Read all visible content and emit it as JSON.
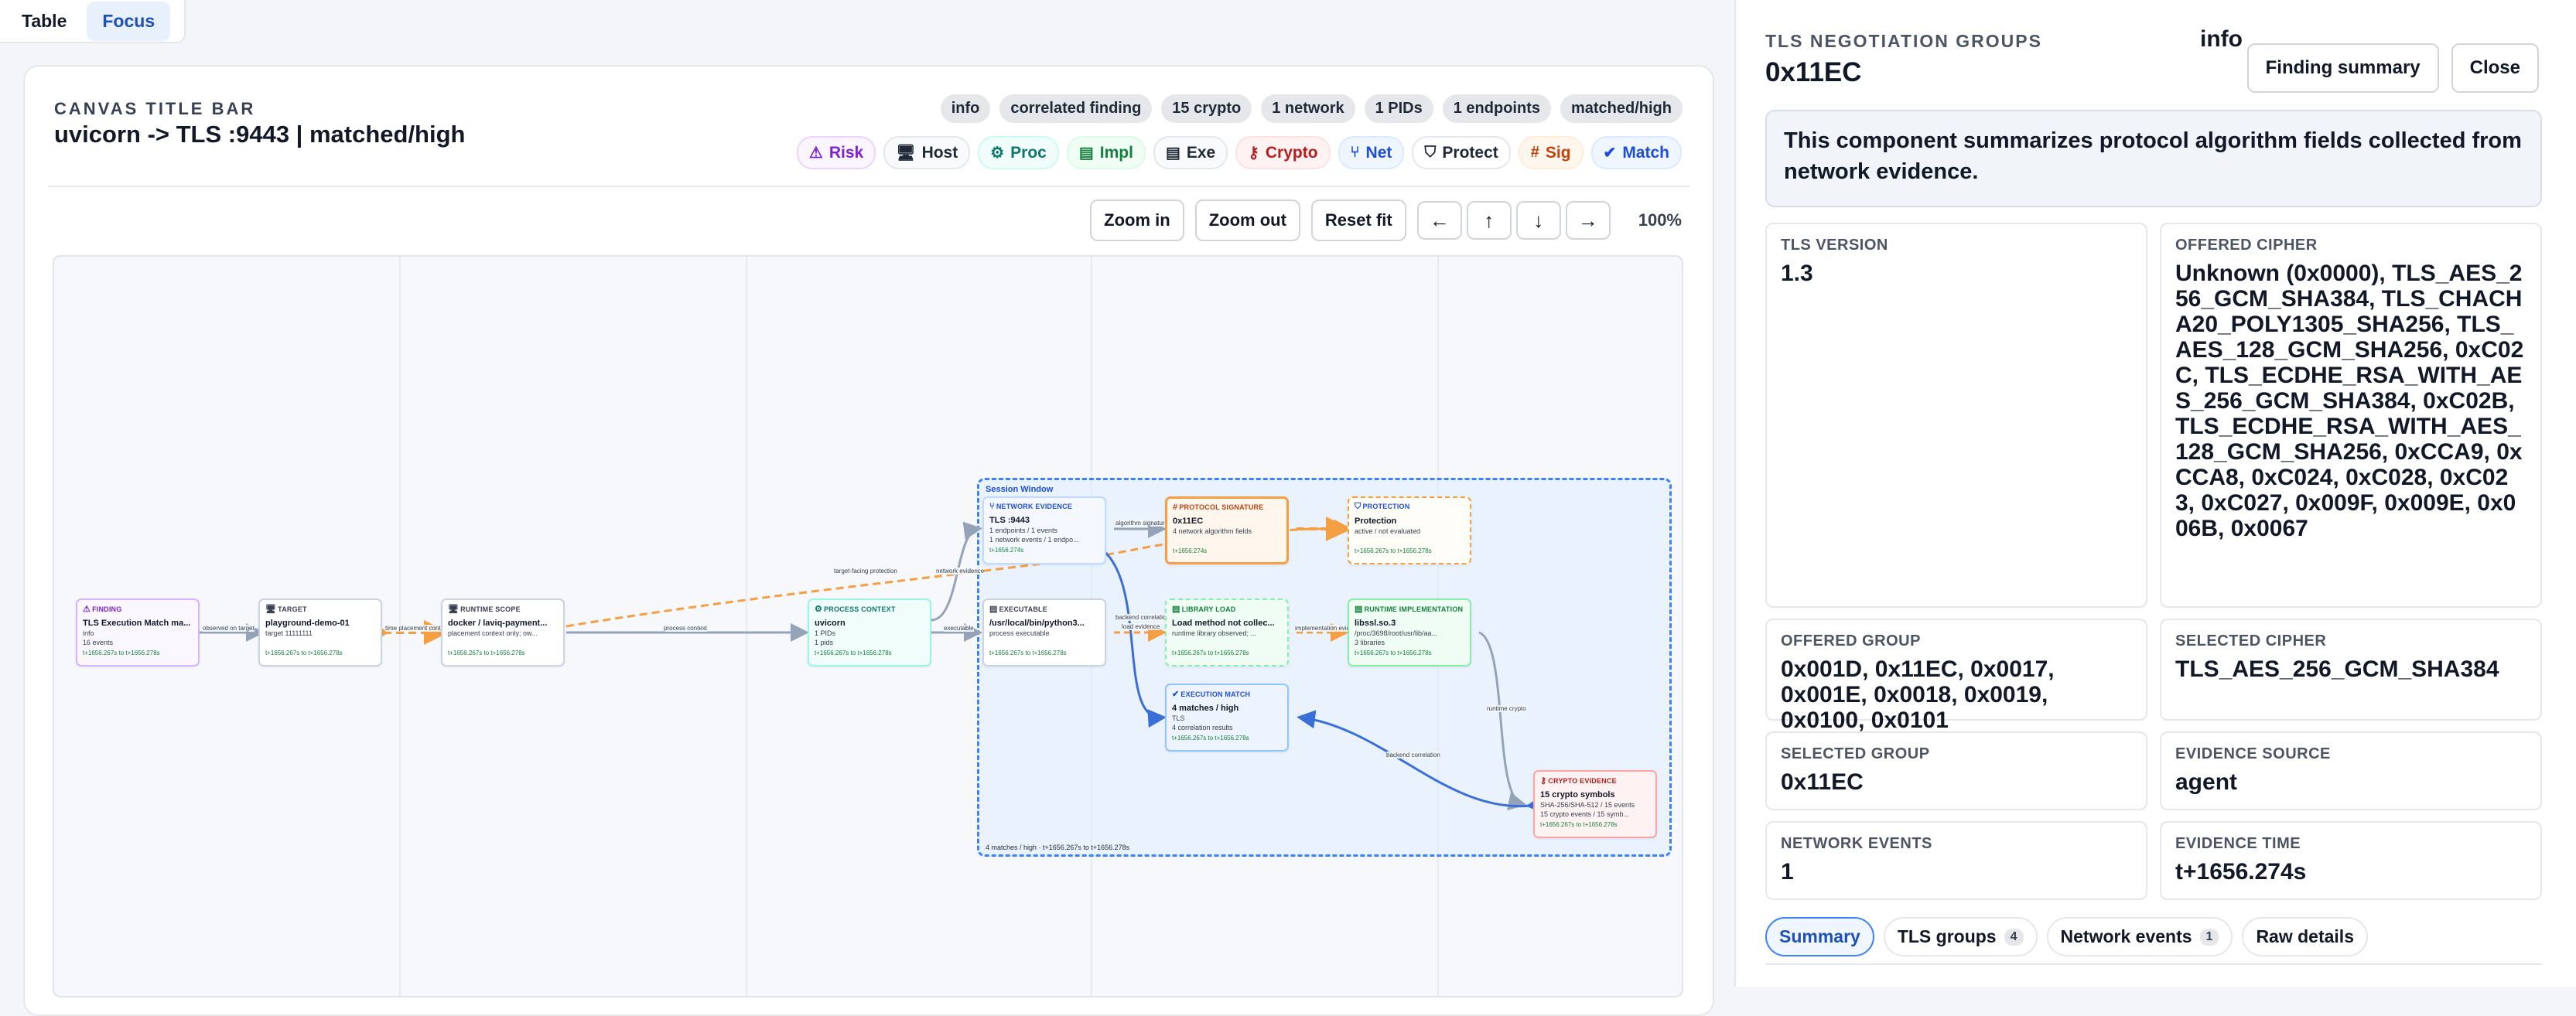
{
  "top_tabs": [
    {
      "label": "Table",
      "active": false
    },
    {
      "label": "Focus",
      "active": true
    }
  ],
  "canvas": {
    "bar_label": "CANVAS TITLE BAR",
    "title": "uvicorn -> TLS :9443 | matched/high",
    "badges": [
      "info",
      "correlated finding",
      "15 crypto",
      "1 network",
      "1 PIDs",
      "1 endpoints",
      "matched/high"
    ],
    "legend": [
      {
        "label": "Risk",
        "icon": "warning-icon",
        "color": "#7e22ce"
      },
      {
        "label": "Host",
        "icon": "monitor-icon",
        "color": "#1f2937"
      },
      {
        "label": "Proc",
        "icon": "cog-icon",
        "color": "#0f766e"
      },
      {
        "label": "Impl",
        "icon": "file-icon",
        "color": "#15803d"
      },
      {
        "label": "Exe",
        "icon": "file-icon",
        "color": "#1f2937"
      },
      {
        "label": "Crypto",
        "icon": "key-icon",
        "color": "#b91c1c"
      },
      {
        "label": "Net",
        "icon": "network-icon",
        "color": "#1d4ed8"
      },
      {
        "label": "Protect",
        "icon": "shield-icon",
        "color": "#1f2937"
      },
      {
        "label": "Sig",
        "icon": "hash-icon",
        "color": "#c2410c"
      },
      {
        "label": "Match",
        "icon": "check-circle-icon",
        "color": "#1d4ed8"
      }
    ],
    "toolbar": {
      "zoom_in": "Zoom in",
      "zoom_out": "Zoom out",
      "reset_fit": "Reset fit",
      "left": "←",
      "up": "↑",
      "down": "↓",
      "right": "→",
      "zoom_level": "100%"
    },
    "session_window": {
      "label": "Session Window",
      "footer": "4 matches / high · t+1656.267s to t+1656.278s"
    },
    "nodes": {
      "finding": {
        "kind": "FINDING",
        "name": "TLS Execution Match ma...",
        "sub1": "info",
        "sub2": "16 events",
        "time": "t+1656.267s to t+1656.278s"
      },
      "target": {
        "kind": "TARGET",
        "name": "playground-demo-01",
        "sub1": "target 11111111",
        "time": "t+1656.267s to t+1656.278s"
      },
      "runtime_scope": {
        "kind": "RUNTIME SCOPE",
        "name": "docker / laviq-payment...",
        "sub1": "placement context only; ow...",
        "time": "t+1656.267s to t+1656.278s"
      },
      "process": {
        "kind": "PROCESS CONTEXT",
        "name": "uvicorn",
        "sub1": "1 PIDs",
        "sub2": "1 pids",
        "time": "t+1656.267s to t+1656.278s"
      },
      "network": {
        "kind": "NETWORK EVIDENCE",
        "name": "TLS :9443",
        "sub1": "1 endpoints / 1 events",
        "sub2": "1 network events / 1 endpo...",
        "time": "t+1656.274s"
      },
      "protocol": {
        "kind": "PROTOCOL SIGNATURE",
        "name": "0x11EC",
        "sub1": "4 network algorithm fields",
        "time": "t+1656.274s"
      },
      "protection": {
        "kind": "PROTECTION",
        "name": "Protection",
        "sub1": "active / not evaluated",
        "time": "t+1656.267s to t+1656.278s"
      },
      "executable": {
        "kind": "EXECUTABLE",
        "name": "/usr/local/bin/python3...",
        "sub1": "process executable",
        "time": "t+1656.267s to t+1656.278s"
      },
      "library": {
        "kind": "LIBRARY LOAD",
        "name": "Load method not collec...",
        "sub1": "runtime library observed; ...",
        "time": "t+1656.267s to t+1656.278s"
      },
      "runtime_impl": {
        "kind": "RUNTIME IMPLEMENTATION",
        "name": "libssl.so.3",
        "sub1": "/proc/3698/root/usr/lib/aa...",
        "sub2": "3 libraries",
        "time": "t+1656.267s to t+1656.278s"
      },
      "execution": {
        "kind": "EXECUTION MATCH",
        "name": "4 matches / high",
        "sub1": "TLS",
        "sub2": "4 correlation results",
        "time": "t+1656.267s to t+1656.278s"
      },
      "crypto": {
        "kind": "CRYPTO EVIDENCE",
        "name": "15 crypto symbols",
        "sub1": "SHA-256/SHA-512 / 15 events",
        "sub2": "15 crypto events / 15 symb...",
        "time": "t+1656.267s to t+1656.278s"
      }
    },
    "edge_labels": {
      "observed_on_target": "observed on target",
      "placement": "time placement cont...",
      "target_facing": "target-facing protection",
      "process_context": "process context",
      "network_evidence": "network evidence",
      "executable": "executable",
      "algorithm_signature": "algorithm signature",
      "backend_correlation_1": "backend correlation",
      "load_evidence": "load evidence",
      "implementation_evidence": "implementation eviden...",
      "runtime_crypto": "runtime crypto",
      "backend_correlation_2": "backend correlation"
    }
  },
  "panel": {
    "label": "TLS NEGOTIATION GROUPS",
    "title": "0x11EC",
    "info": "info",
    "finding_summary": "Finding summary",
    "close": "Close",
    "summary": "This component summarizes protocol algorithm fields collected from network evidence.",
    "fields": [
      {
        "label": "TLS VERSION",
        "value": "1.3"
      },
      {
        "label": "OFFERED CIPHER",
        "value": "Unknown (0x0000), TLS_AES_256_GCM_SHA384, TLS_CHACHA20_POLY1305_SHA256, TLS_AES_128_GCM_SHA256, 0xC02C, TLS_ECDHE_RSA_WITH_AES_256_GCM_SHA384, 0xC02B, TLS_ECDHE_RSA_WITH_AES_128_GCM_SHA256, 0xCCA9, 0xCCA8, 0xC024, 0xC028, 0xC023, 0xC027, 0x009F, 0x009E, 0x006B, 0x0067"
      },
      {
        "label": "OFFERED GROUP",
        "value": "0x001D, 0x11EC, 0x0017, 0x001E, 0x0018, 0x0019, 0x0100, 0x0101"
      },
      {
        "label": "SELECTED CIPHER",
        "value": "TLS_AES_256_GCM_SHA384"
      },
      {
        "label": "SELECTED GROUP",
        "value": "0x11EC"
      },
      {
        "label": "EVIDENCE SOURCE",
        "value": "agent"
      },
      {
        "label": "NETWORK EVENTS",
        "value": "1"
      },
      {
        "label": "EVIDENCE TIME",
        "value": "t+1656.274s"
      }
    ],
    "tabs": [
      {
        "label": "Summary",
        "count": "",
        "active": true
      },
      {
        "label": "TLS groups",
        "count": "4",
        "active": false
      },
      {
        "label": "Network events",
        "count": "1",
        "active": false
      },
      {
        "label": "Raw details",
        "count": "",
        "active": false
      }
    ]
  }
}
